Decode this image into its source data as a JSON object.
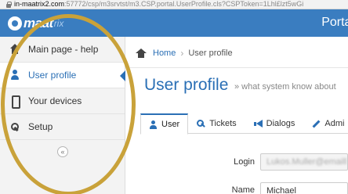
{
  "browser": {
    "url_host": "in-maatrix2.com",
    "url_path": ":57772/csp/m3srvtst/m3.CSP.portal.UserProfile.cls?CSPToken=1Lhl£lzt5wGi"
  },
  "header": {
    "logo_text": "maat",
    "logo_suffix": "rix",
    "title": "Portal"
  },
  "sidebar": {
    "items": [
      {
        "label": "Main page - help",
        "icon": "home-icon"
      },
      {
        "label": "User profile",
        "icon": "user-icon",
        "active": true
      },
      {
        "label": "Your devices",
        "icon": "mobile-icon"
      },
      {
        "label": "Setup",
        "icon": "gear-icon"
      }
    ],
    "collapse_label": "«"
  },
  "breadcrumb": {
    "home": "Home",
    "separator": "›",
    "current": "User profile"
  },
  "page": {
    "title": "User profile",
    "subtitle": "» what system know about"
  },
  "tabs": [
    {
      "label": "User",
      "icon": "user-icon",
      "active": true
    },
    {
      "label": "Tickets",
      "icon": "key-icon"
    },
    {
      "label": "Dialogs",
      "icon": "bullhorn-icon"
    },
    {
      "label": "Admi",
      "icon": "wrench-icon"
    }
  ],
  "form": {
    "login_label": "Login",
    "login_value": "Lukos.Muller@emaill",
    "name_label": "Name",
    "name_value": "Michael"
  },
  "colors": {
    "brand": "#3a7dc0",
    "accent": "#2a6fb5",
    "annotation": "#c9a23a"
  }
}
